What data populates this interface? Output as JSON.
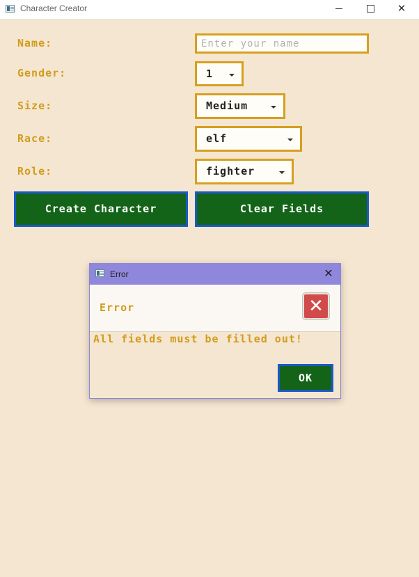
{
  "window": {
    "title": "Character Creator",
    "controls": {
      "minimize_icon": "minimize-icon",
      "maximize_icon": "maximize-icon",
      "close_icon": "close-icon"
    }
  },
  "form": {
    "name": {
      "label": "Name:",
      "value": "",
      "placeholder": "Enter your name"
    },
    "gender": {
      "label": "Gender:",
      "value": "1"
    },
    "size": {
      "label": "Size:",
      "value": "Medium"
    },
    "race": {
      "label": "Race:",
      "value": "elf"
    },
    "role": {
      "label": "Role:",
      "value": "fighter"
    }
  },
  "buttons": {
    "create_label": "Create Character",
    "clear_label": "Clear Fields"
  },
  "dialog": {
    "title": "Error",
    "heading": "Error",
    "message": "All fields must be filled out!",
    "ok_label": "OK",
    "icon": "error-x-icon"
  },
  "colors": {
    "background": "#f5e6d1",
    "label_gold": "#d19c1d",
    "field_border": "#d5a021",
    "button_green": "#136418",
    "button_border": "#1a59c7",
    "dialog_titlebar": "#8e87dc",
    "error_red": "#d14b4b"
  }
}
